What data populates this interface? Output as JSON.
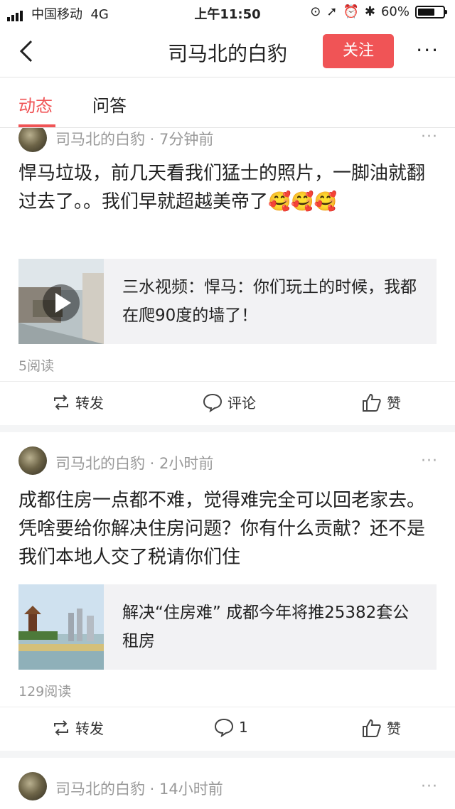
{
  "status_bar": {
    "carrier": "中国移动",
    "network": "4G",
    "time": "上午11:50",
    "battery": "60%"
  },
  "nav": {
    "title": "司马北的白豹",
    "follow_label": "关注"
  },
  "tabs": [
    {
      "label": "动态"
    },
    {
      "label": "问答"
    }
  ],
  "posts": [
    {
      "author": "司马北的白豹",
      "time": "7分钟前",
      "text": "悍马垃圾，前几天看我们猛士的照片，一脚油就翻过去了。。我们早就超越美帝了🥰🥰🥰",
      "link_text": "三水视频：悍马：你们玩土的时候，我都在爬90度的墙了！",
      "reads": "5阅读",
      "repost_label": "转发",
      "comment_label": "评论",
      "like_label": "赞"
    },
    {
      "author": "司马北的白豹",
      "time": "2小时前",
      "text": "成都住房一点都不难，觉得难完全可以回老家去。凭啥要给你解决住房问题？你有什么贡献？还不是我们本地人交了税请你们住",
      "link_text": "解决“住房难” 成都今年将推25382套公租房",
      "reads": "129阅读",
      "repost_label": "转发",
      "comment_label": "1",
      "like_label": "赞"
    },
    {
      "author": "司马北的白豹",
      "time": "14小时前"
    }
  ]
}
